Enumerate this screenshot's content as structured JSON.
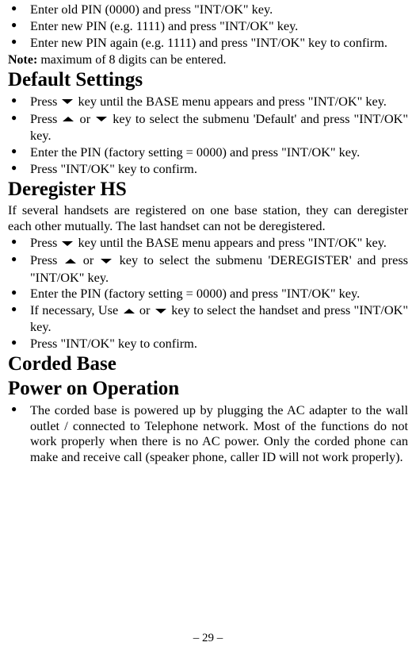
{
  "top_bullets": [
    "Enter old PIN (0000) and press \"INT/OK\" key.",
    "Enter new PIN (e.g. 1111) and press \"INT/OK\" key.",
    "Enter new PIN again (e.g. 1111) and press \"INT/OK\" key to confirm."
  ],
  "note_label": "Note:",
  "note_text": " maximum of 8 digits can be entered.",
  "default_heading": "Default Settings",
  "default_b1a": "Press ",
  "default_b1b": " key until the BASE menu appears and press \"INT/OK\" key.",
  "default_b2a": "Press ",
  "default_b2b": " or ",
  "default_b2c": " key to select the submenu 'Default' and press \"INT/OK\" key.",
  "default_b3": "Enter the PIN (factory setting = 0000) and press \"INT/OK\" key.",
  "default_b4": "Press \"INT/OK\" key to confirm.",
  "dereg_heading": "Deregister HS",
  "dereg_intro": "If several handsets are registered on one base station, they can deregister each other mutually. The last handset can not be deregistered.",
  "dereg_b1a": "Press ",
  "dereg_b1b": " key until the BASE menu appears and press \"INT/OK\" key.",
  "dereg_b2a": "Press ",
  "dereg_b2b": " or ",
  "dereg_b2c": " key to select the submenu 'DEREGISTER' and press \"INT/OK\" key.",
  "dereg_b3": "Enter the PIN (factory setting = 0000) and press \"INT/OK\" key.",
  "dereg_b4a": "If necessary, Use ",
  "dereg_b4b": " or ",
  "dereg_b4c": " key to select the handset and press \"INT/OK\" key.",
  "dereg_b5": "Press \"INT/OK\" key to confirm.",
  "corded_heading": "Corded Base",
  "power_heading": "Power on Operation",
  "power_b1": "The corded base is powered up by plugging the AC adapter to the wall outlet / connected to Telephone network. Most of the functions do not work properly when there is no AC power. Only the corded phone can make and receive call (speaker phone, caller ID will not work properly).",
  "page_number": "– 29 –"
}
